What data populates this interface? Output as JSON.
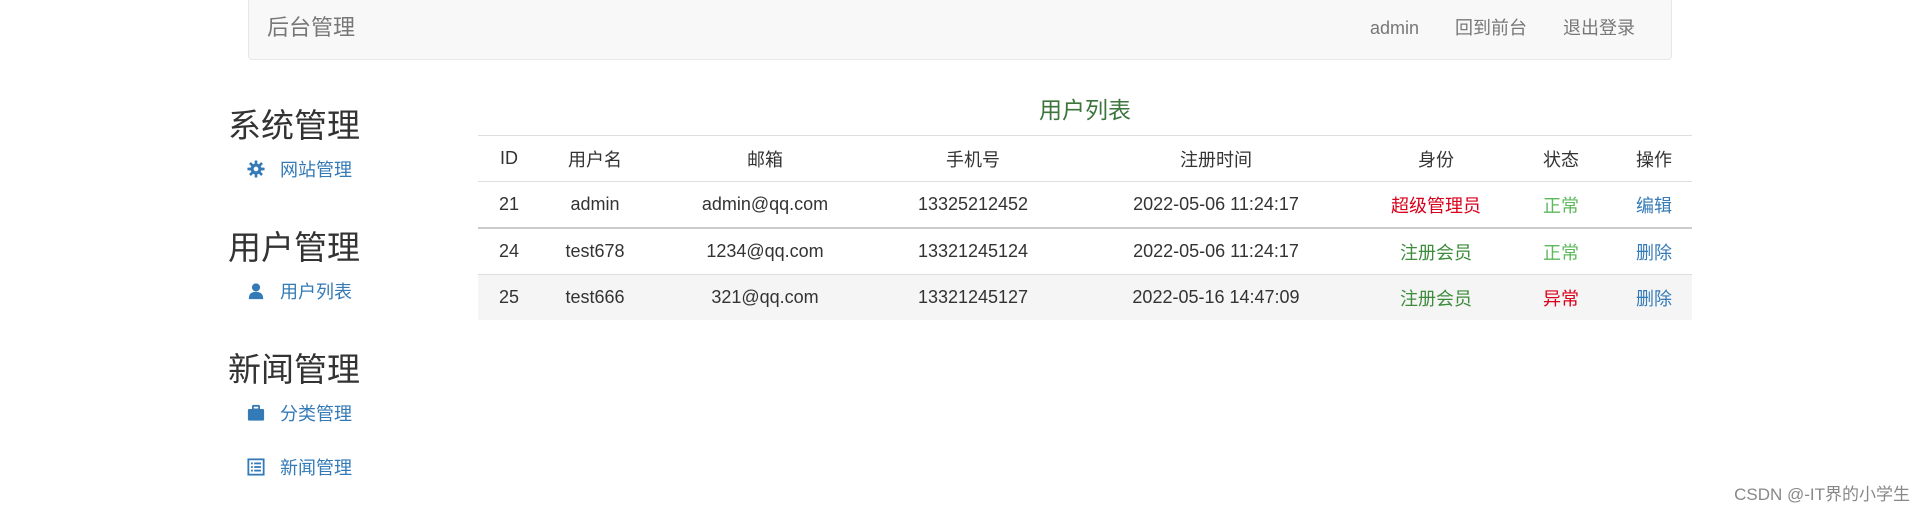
{
  "navbar": {
    "brand": "后台管理",
    "links": [
      "admin",
      "回到前台",
      "退出登录"
    ]
  },
  "sidebar": {
    "groups": [
      {
        "heading": "系统管理",
        "items": [
          {
            "label": "网站管理",
            "icon": "gear-icon"
          }
        ]
      },
      {
        "heading": "用户管理",
        "items": [
          {
            "label": "用户列表",
            "icon": "user-icon"
          }
        ]
      },
      {
        "heading": "新闻管理",
        "items": [
          {
            "label": "分类管理",
            "icon": "briefcase-icon"
          },
          {
            "label": "新闻管理",
            "icon": "list-alt-icon"
          }
        ]
      }
    ]
  },
  "table": {
    "title": "用户列表",
    "columns": [
      "ID",
      "用户名",
      "邮箱",
      "手机号",
      "注册时间",
      "身份",
      "状态",
      "操作"
    ],
    "rows": [
      {
        "id": "21",
        "username": "admin",
        "email": "admin@qq.com",
        "phone": "13325212452",
        "registered": "2022-05-06 11:24:17",
        "role": "超级管理员",
        "status": "正常",
        "action": "编辑"
      },
      {
        "id": "24",
        "username": "test678",
        "email": "1234@qq.com",
        "phone": "13321245124",
        "registered": "2022-05-06 11:24:17",
        "role": "注册会员",
        "status": "正常",
        "action": "删除"
      },
      {
        "id": "25",
        "username": "test666",
        "email": "321@qq.com",
        "phone": "13321245127",
        "registered": "2022-05-16 14:47:09",
        "role": "注册会员",
        "status": "异常",
        "action": "删除"
      }
    ]
  },
  "colors": {
    "link": "#337ab7",
    "title_green": "#3c763d",
    "danger": "#d9001b",
    "success": "#5cb85c"
  },
  "watermark": "CSDN @-IT界的小学生"
}
